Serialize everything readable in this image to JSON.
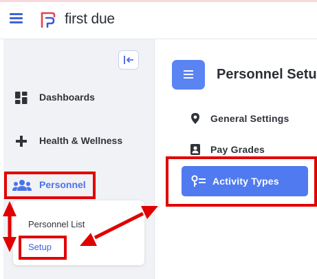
{
  "app": {
    "brand": "first due"
  },
  "sidebar": {
    "items": [
      {
        "label": "Dashboards",
        "icon": "dashboard-icon"
      },
      {
        "label": "Health & Wellness",
        "icon": "plus-icon"
      },
      {
        "label": "Personnel",
        "icon": "people-icon",
        "active": true
      }
    ],
    "submenu": {
      "items": [
        {
          "label": "Personnel List"
        },
        {
          "label": "Setup",
          "active": true
        }
      ]
    }
  },
  "main": {
    "page_title": "Personnel Setu",
    "settings": [
      {
        "label": "General Settings",
        "icon": "location-pin-icon"
      },
      {
        "label": "Pay Grades",
        "icon": "id-badge-icon"
      },
      {
        "label": "Activity Types",
        "icon": "activity-types-icon",
        "active": true
      }
    ]
  },
  "colors": {
    "accent": "#4f7af0",
    "active_text": "#4b73ea",
    "annotation": "#e00000",
    "logo_red": "#e8414b",
    "logo_blue": "#3d5bd9"
  }
}
